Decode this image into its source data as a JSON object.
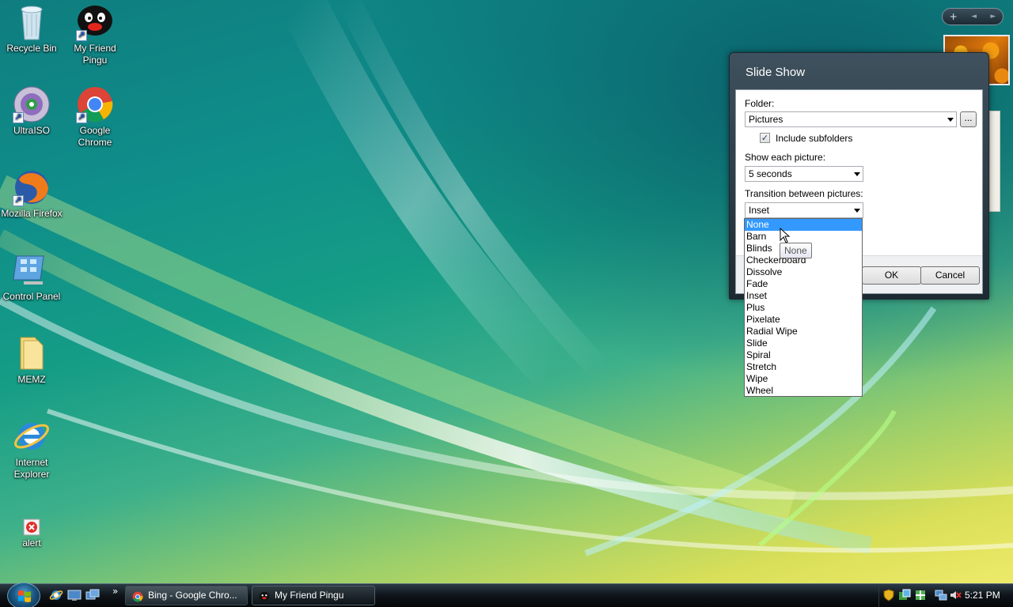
{
  "desktop": {
    "icons": [
      {
        "label": "Recycle Bin"
      },
      {
        "label": "My Friend Pingu"
      },
      {
        "label": "UltraISO"
      },
      {
        "label": "Google Chrome"
      },
      {
        "label": "Mozilla Firefox"
      },
      {
        "label": "Control Panel"
      },
      {
        "label": "MEMZ"
      },
      {
        "label": "Internet Explorer"
      },
      {
        "label": "alert"
      }
    ]
  },
  "gadget": {
    "controls": [
      "+",
      "◄",
      "►"
    ]
  },
  "dialog": {
    "title": "Slide Show",
    "folder_label": "Folder:",
    "folder_value": "Pictures",
    "browse_label": "...",
    "include_subfolders_label": "Include subfolders",
    "include_subfolders_checked": true,
    "show_each_label": "Show each picture:",
    "show_each_value": "5 seconds",
    "transition_label": "Transition between pictures:",
    "transition_value": "Inset",
    "ok_label": "OK",
    "cancel_label": "Cancel"
  },
  "transition_options": [
    "None",
    "Barn",
    "Blinds",
    "Checkerboard",
    "Dissolve",
    "Fade",
    "Inset",
    "Plus",
    "Pixelate",
    "Radial Wipe",
    "Slide",
    "Spiral",
    "Stretch",
    "Wipe",
    "Wheel"
  ],
  "highlighted_option": "None",
  "tooltip": "None",
  "taskbar": {
    "tasks": [
      {
        "label": "Bing - Google Chro..."
      },
      {
        "label": "My Friend Pingu"
      }
    ],
    "quicklaunch_more": "»",
    "clock": "5:21 PM"
  },
  "colors": {
    "selection": "#3399ff",
    "dialog_frame": "#2b3a44"
  }
}
